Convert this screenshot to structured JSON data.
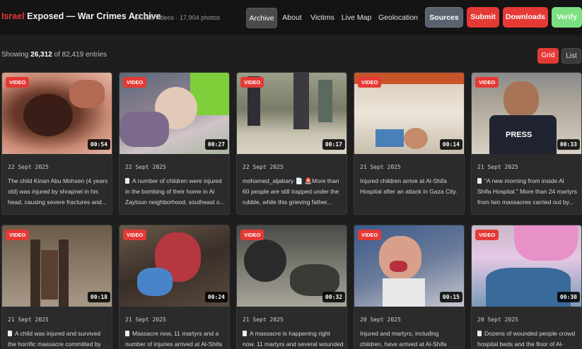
{
  "header": {
    "brand_accent": "Israel",
    "brand_rest": "Exposed — War Crimes Archive",
    "stats": "64,515 videos · 17,904 photos",
    "nav": [
      "Archive",
      "About",
      "Victims",
      "Live Map",
      "Geolocation"
    ],
    "active_nav": "Archive",
    "buttons": {
      "sources": "Sources",
      "submit": "Submit",
      "downloads": "Downloads",
      "verify": "Verify"
    }
  },
  "listing": {
    "showing_prefix": "Showing",
    "showing_count": "26,312",
    "showing_suffix": "of 82,419 entries",
    "view_grid": "Grid",
    "view_list": "List"
  },
  "colors": {
    "brand_red": "#e53935",
    "sources_bg": "#5a6270",
    "verify_bg": "#7ce082",
    "background": "#1e1e1e"
  },
  "cards": [
    {
      "badge": "VIDEO",
      "duration": "00:54",
      "date": "22 Sept 2025",
      "icon": "",
      "text": "The child Kinan Abu Mohsen (4 years old) was injured by shrapnel in his head, causing severe fractures and..."
    },
    {
      "badge": "VIDEO",
      "duration": "00:27",
      "date": "22 Sept 2025",
      "icon": "document-icon",
      "text": "A number of children were injured in the bombing of their home in Al Zaytoun neighborhood, southeast o..."
    },
    {
      "badge": "VIDEO",
      "duration": "00:17",
      "date": "22 Sept 2025",
      "icon": "user-icon",
      "text": "mohamed_aljabary 📄 🚨More than 60 people are still trapped under the rubble, while this grieving father..."
    },
    {
      "badge": "VIDEO",
      "duration": "00:14",
      "date": "21 Sept 2025",
      "icon": "",
      "text": "Injured children arrive at Al-Shifa Hospital after an attack in Gaza City."
    },
    {
      "badge": "VIDEO",
      "duration": "00:33",
      "date": "21 Sept 2025",
      "icon": "document-icon",
      "text": "\"A new morning from inside Al Shifa Hospital.\" More than 24 martyrs from two massacres carried out by..."
    },
    {
      "badge": "VIDEO",
      "duration": "00:18",
      "date": "21 Sept 2025",
      "icon": "document-icon",
      "text": "A child was injured and survived the horrific massacre committed by"
    },
    {
      "badge": "VIDEO",
      "duration": "00:24",
      "date": "21 Sept 2025",
      "icon": "document-icon",
      "text": "Massacre now, 11 martyrs and a number of injuries arrived at Al-Shifa"
    },
    {
      "badge": "VIDEO",
      "duration": "00:32",
      "date": "21 Sept 2025",
      "icon": "document-icon",
      "text": "A massacre is happening right now. 11 martyrs and several wounded"
    },
    {
      "badge": "VIDEO",
      "duration": "00:15",
      "date": "20 Sept 2025",
      "icon": "",
      "text": "Injured and martyrs, including children, have arrived at Al-Shifa"
    },
    {
      "badge": "VIDEO",
      "duration": "00:30",
      "date": "20 Sept 2025",
      "icon": "document-icon",
      "text": "Dozens of wounded people crowd hospital beds and the floor of Al-"
    }
  ]
}
